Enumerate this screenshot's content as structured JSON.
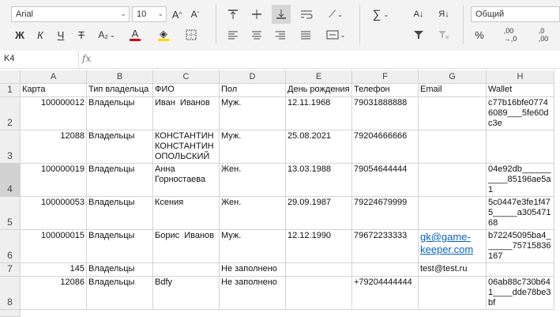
{
  "toolbar": {
    "font_name": "Arial",
    "font_size": "10",
    "bold": "Ж",
    "italic": "К",
    "underline": "Ч",
    "strike": "Т",
    "subscript": "A₂",
    "font_color_glyph": "A",
    "number_format": "Общий",
    "percent": "%",
    "sum_glyph": "∑",
    "font_color": "#d0021b",
    "fill_color": "#ffd600"
  },
  "formula_bar": {
    "cell_ref": "K4",
    "fx": "fx",
    "value": ""
  },
  "columns": [
    "A",
    "B",
    "C",
    "D",
    "E",
    "F",
    "G",
    "H"
  ],
  "rows": [
    {
      "num": "1",
      "cells": [
        "Карта",
        "Тип владельца",
        "ФИО",
        "Пол",
        "День рождения",
        "Телефон",
        "Email",
        "Wallet"
      ]
    },
    {
      "num": "2",
      "cells": [
        "100000012",
        "Владельцы",
        "Иван  Иванов",
        "Муж.",
        "12.11.1968",
        "79031888888",
        "",
        "c77b16bfe07746089___5fe60dc3e"
      ]
    },
    {
      "num": "3",
      "cells": [
        "12088",
        "Владельцы",
        "КОНСТАНТИН КОНСТАНТИН ОПОЛЬСКИЙ",
        "Муж.",
        "25.08.2021",
        "79204666666",
        "",
        ""
      ]
    },
    {
      "num": "4",
      "cells": [
        "100000019",
        "Владельцы",
        "Анна Горностаева",
        "Жен.",
        "13.03.1988",
        "79054644444",
        "",
        "04e92db__________85196ae5a1"
      ]
    },
    {
      "num": "5",
      "cells": [
        "100000053",
        "Владельцы",
        "Ксения",
        "Жен.",
        "29.09.1987",
        "79224679999",
        "",
        "5c0447e3fe1f475_____a30547168"
      ]
    },
    {
      "num": "6",
      "cells": [
        "100000015",
        "Владельцы",
        "Борис  Иванов",
        "Муж.",
        "12.12.1990",
        "79672233333",
        "gk@game-keeper.com",
        "b72245095ba4______75715836167"
      ]
    },
    {
      "num": "7",
      "cells": [
        "145",
        "Владельцы",
        "",
        "Не заполнено",
        "",
        "",
        "test@test.ru",
        ""
      ]
    },
    {
      "num": "8",
      "cells": [
        "12086",
        "Владельцы",
        "Bdfy",
        "Не заполнено",
        "",
        "+79204444444",
        "",
        "06ab88c730b641____dde78be3bf"
      ]
    }
  ]
}
